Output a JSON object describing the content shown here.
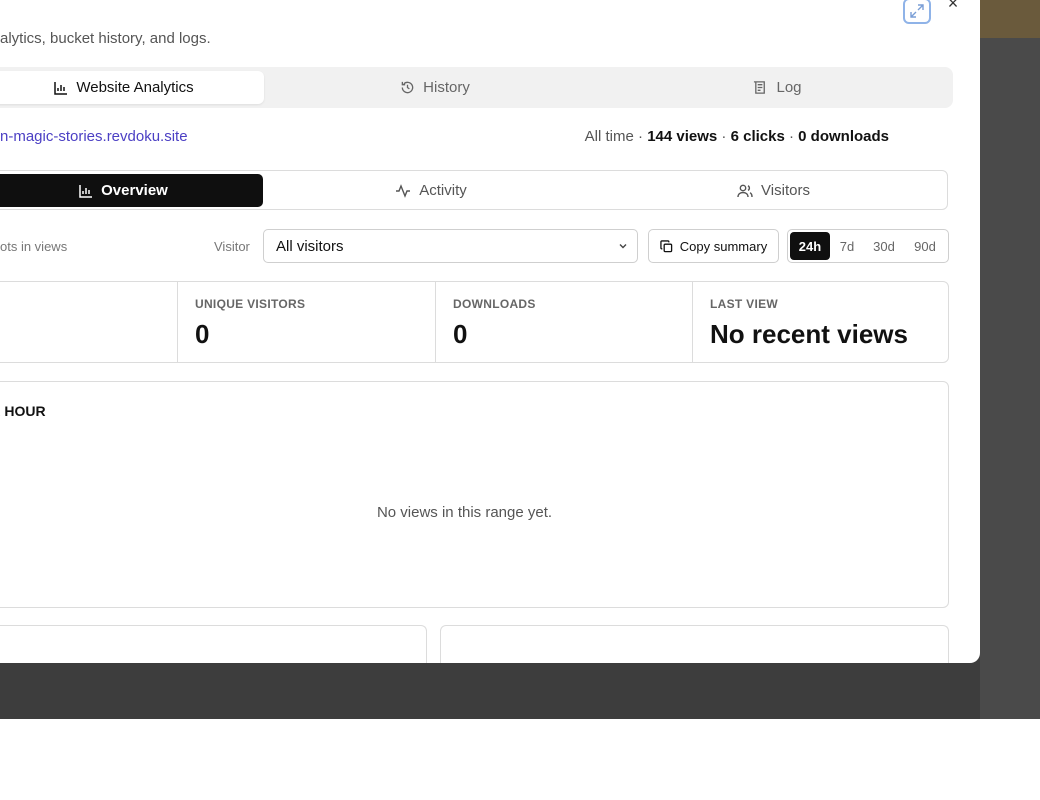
{
  "header": {
    "subtitle": "alytics, bucket history, and logs."
  },
  "tabs": [
    {
      "label": "Website Analytics",
      "icon": "bar-chart-icon"
    },
    {
      "label": "History",
      "icon": "history-icon"
    },
    {
      "label": "Log",
      "icon": "log-icon"
    }
  ],
  "site": {
    "link": "n-magic-stories.revdoku.site",
    "stats_prefix": "All time · ",
    "views": "144 views",
    "sep1": " · ",
    "clicks": "6 clicks",
    "sep2": " · ",
    "downloads": "0 downloads"
  },
  "subtabs": [
    {
      "label": "Overview",
      "icon": "bar-chart-icon"
    },
    {
      "label": "Activity",
      "icon": "activity-icon"
    },
    {
      "label": "Visitors",
      "icon": "users-icon"
    }
  ],
  "filters": {
    "note": "ots in views",
    "visitor_label": "Visitor",
    "visitor_value": "All visitors",
    "copy_label": "Copy summary",
    "ranges": [
      "24h",
      "7d",
      "30d",
      "90d"
    ],
    "active_range": "24h"
  },
  "stats": [
    {
      "label": "UNIQUE VISITORS",
      "value": "0"
    },
    {
      "label": "DOWNLOADS",
      "value": "0"
    },
    {
      "label": "LAST VIEW",
      "value": "No recent views"
    }
  ],
  "chart": {
    "title": "ER HOUR",
    "empty": "No views in this range yet."
  },
  "colors": {
    "accent": "#4b3fc4",
    "active_tab": "#0f0f0f",
    "backdrop": "#3d3d3d"
  }
}
